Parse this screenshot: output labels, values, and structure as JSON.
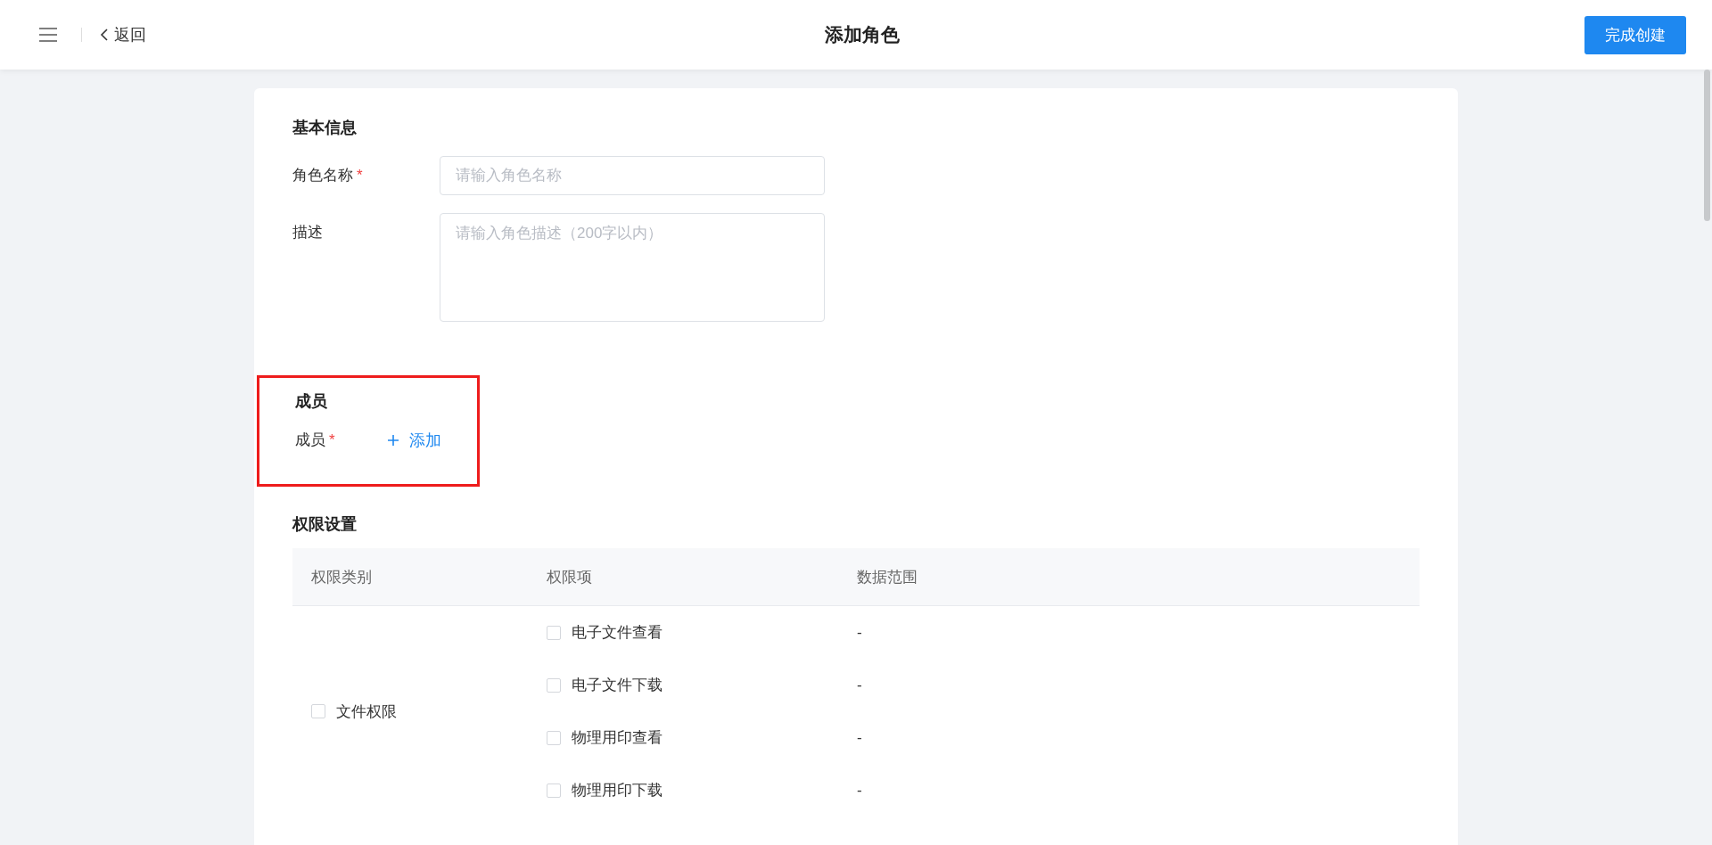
{
  "header": {
    "back_label": "返回",
    "title": "添加角色",
    "submit_label": "完成创建"
  },
  "basic": {
    "title": "基本信息",
    "fields": [
      {
        "kind": "input",
        "label": "角色名称",
        "required_mark": "*",
        "placeholder": "请输入角色名称"
      },
      {
        "kind": "textarea",
        "label": "描述",
        "placeholder": "请输入角色描述（200字以内）"
      }
    ]
  },
  "members": {
    "title": "成员",
    "label": "成员",
    "required_mark": "*",
    "add_label": "添加",
    "highlighted": true
  },
  "permissions": {
    "title": "权限设置",
    "columns": [
      "权限类别",
      "权限项",
      "数据范围"
    ],
    "groups": [
      {
        "category": "文件权限",
        "checked": false,
        "items": [
          {
            "label": "电子文件查看",
            "checked": false,
            "scope": "-"
          },
          {
            "label": "电子文件下载",
            "checked": false,
            "scope": "-"
          },
          {
            "label": "物理用印查看",
            "checked": false,
            "scope": "-"
          },
          {
            "label": "物理用印下载",
            "checked": false,
            "scope": "-"
          }
        ]
      }
    ]
  }
}
